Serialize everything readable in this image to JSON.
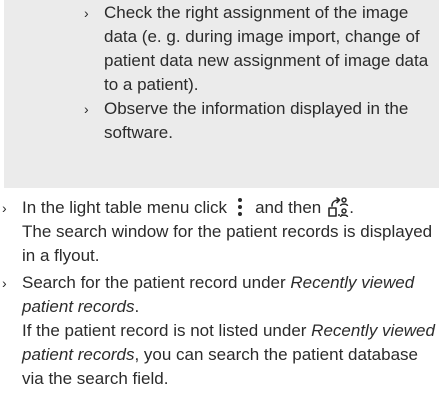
{
  "note": {
    "items": [
      "Check the right assignment of the image data (e. g. during image import, change of patient data new assignment of image data to a patient).",
      "Observe the information displayed in the software."
    ]
  },
  "steps": {
    "step1": {
      "text_before": "In the light table menu click",
      "text_middle": "and then",
      "text_after": ".",
      "line2": "The search window for the patient records is displayed in a flyout.",
      "menu_icon": "vertical-ellipsis-icon",
      "search_icon": "patient-record-search-icon"
    },
    "step2": {
      "text_before": "Search for the patient record under ",
      "emphasis": "Recently viewed patient records",
      "text_after": ".",
      "line2_before": "If the patient record is not listed under ",
      "line2_emphasis": "Recently viewed patient records",
      "line2_after": ", you can search the patient database via the search field."
    }
  },
  "bullet_glyph": "›",
  "colors": {
    "note_background": "#ebebeb",
    "text": "#2b2b2b"
  }
}
